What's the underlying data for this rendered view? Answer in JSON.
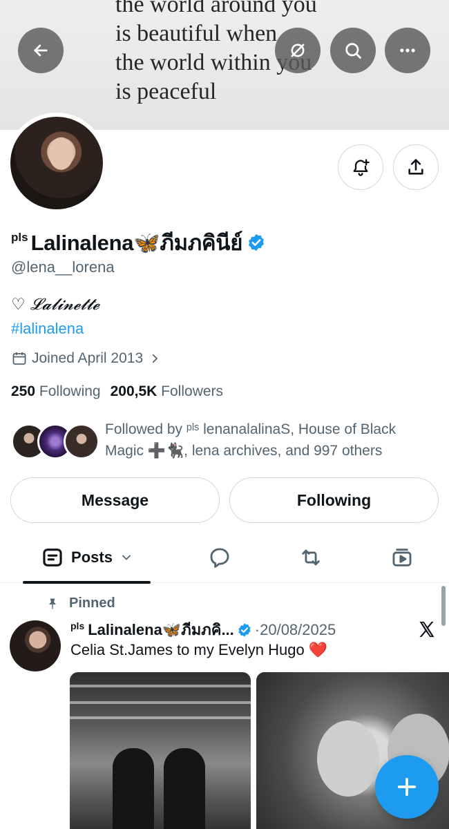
{
  "banner": {
    "quote_lines": [
      "the world around you",
      "is beautiful when",
      "the world within you",
      "is peaceful"
    ]
  },
  "profile": {
    "name_prefix": "pls",
    "display_name": "Lalinalena🦋ภีมภคินีย์",
    "handle": "@lena__lorena",
    "bio_line1": "♡ 𝓛𝓪𝓵𝓲𝓷𝓮𝓽𝓽𝓮",
    "bio_hashtag": "#lalinalena",
    "joined": "Joined April 2013",
    "following_count": "250",
    "following_label": "Following",
    "followers_count": "200,5K",
    "followers_label": "Followers",
    "followed_by": "Followed by ᵖˡˢ lenanalalinaS, House of Black Magic ➕🐈‍⬛, lena archives, and 997 others"
  },
  "actions": {
    "message_label": "Message",
    "following_label": "Following"
  },
  "tabs": {
    "posts_label": "Posts"
  },
  "post": {
    "pinned_label": "Pinned",
    "name_prefix": "pls",
    "author": "Lalinalena🦋ภีมภคิ...",
    "date": "·20/08/2025",
    "text": "Celia St.James to my Evelyn Hugo",
    "emoji": "❤️"
  },
  "icons": {
    "back": "back-arrow-icon",
    "grok": "grok-icon",
    "search": "search-icon",
    "more": "more-icon",
    "bell": "notification-bell-icon",
    "share": "share-icon",
    "verified": "verified-badge-icon",
    "calendar": "calendar-icon",
    "posts": "posts-icon",
    "replies": "replies-icon",
    "reposts": "reposts-icon",
    "media": "media-icon",
    "pin": "pin-icon",
    "x": "x-logo-icon",
    "compose": "compose-plus-icon"
  },
  "colors": {
    "accent": "#1d9bf0",
    "text_primary": "#0f1419",
    "text_secondary": "#536471"
  }
}
